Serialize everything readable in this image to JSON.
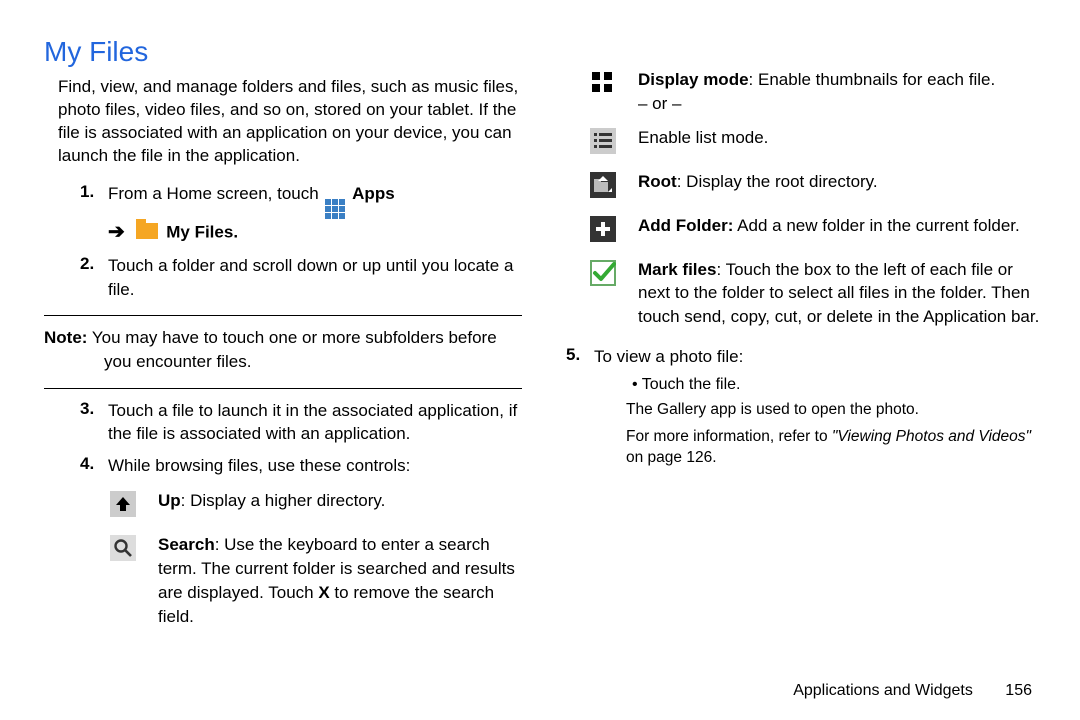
{
  "left": {
    "title": "My Files",
    "intro": "Find, view, and manage folders and files, such as music files, photo files, video files, and so on, stored on your tablet. If the file is associated with an application on your device, you can launch the file in the application.",
    "step1_num": "1.",
    "step1_a": "From a Home screen, touch ",
    "apps_label": "Apps",
    "myfiles_label": "My Files",
    "step2_num": "2.",
    "step2": "Touch a folder and scroll down or up until you locate a file.",
    "note_lead": "Note:",
    "note_text": " You may have to touch one or more subfolders before",
    "note_text2": "you encounter files.",
    "step3_num": "3.",
    "step3": "Touch a file to launch it in the associated application, if the file is associated with an application.",
    "step4_num": "4.",
    "step4": "While browsing files, use these controls:",
    "up_bold": "Up",
    "up_text": ": Display a higher directory.",
    "search_bold": "Search",
    "search_text": ": Use the keyboard to enter a search term. The current folder is searched and results are displayed. Touch ",
    "search_x": "X",
    "search_tail": " to remove the search field."
  },
  "right": {
    "display_bold": "Display mode",
    "display_text": ": Enable thumbnails for each file.",
    "or": "– or –",
    "list_text": "Enable list mode.",
    "root_bold": "Root",
    "root_text": ": Display the root directory.",
    "addfolder_bold": "Add Folder:",
    "addfolder_text": " Add a new folder in the current folder.",
    "mark_bold": "Mark files",
    "mark_text": ": Touch the box to the left of each file or next to the folder to select all files in the folder. Then touch send, copy, cut, or delete in the Application bar.",
    "step5_num": "5.",
    "step5": "To view a photo file:",
    "bullet": "•  Touch the file.",
    "gallery": "The Gallery app is used to open the photo.",
    "moreinfo_a": "For more information, refer to ",
    "moreinfo_link": "\"Viewing Photos and Videos\"",
    "moreinfo_b": " on page 126."
  },
  "footer": {
    "section": "Applications and Widgets",
    "page": "156"
  }
}
